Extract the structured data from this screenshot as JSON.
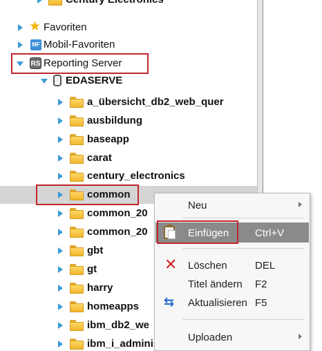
{
  "tree": {
    "items": [
      {
        "label": "Century Electronics",
        "bold": true
      },
      {
        "label": "Favoriten"
      },
      {
        "label": "Mobil-Favoriten",
        "icon_text": "MF"
      },
      {
        "label": "Reporting Server",
        "icon_text": "RS"
      },
      {
        "label": "EDASERVE",
        "bold": true
      },
      {
        "label": "a_übersicht_db2_web_quer",
        "bold": true
      },
      {
        "label": "ausbildung",
        "bold": true
      },
      {
        "label": "baseapp",
        "bold": true
      },
      {
        "label": "carat",
        "bold": true
      },
      {
        "label": "century_electronics",
        "bold": true
      },
      {
        "label": "common",
        "bold": true
      },
      {
        "label": "common_20",
        "bold": true
      },
      {
        "label": "common_20",
        "bold": true
      },
      {
        "label": "gbt",
        "bold": true
      },
      {
        "label": "gt",
        "bold": true
      },
      {
        "label": "harry",
        "bold": true
      },
      {
        "label": "homeapps",
        "bold": true
      },
      {
        "label": "ibm_db2_we",
        "bold": true
      },
      {
        "label": "ibm_i_administration_samp",
        "bold": true
      }
    ]
  },
  "context_menu": {
    "items": [
      {
        "label": "Neu",
        "shortcut": "",
        "has_submenu": true
      },
      {
        "label": "Einfügen",
        "shortcut": "Ctrl+V",
        "active": true
      },
      {
        "label": "Löschen",
        "shortcut": "DEL"
      },
      {
        "label": "Titel ändern",
        "shortcut": "F2"
      },
      {
        "label": "Aktualisieren",
        "shortcut": "F5"
      },
      {
        "label": "Uploaden",
        "shortcut": "",
        "has_submenu": true
      }
    ]
  },
  "colors": {
    "expander": "#3a9ad6",
    "highlight_box": "#c0262c",
    "selected_row": "#d5d5d5",
    "menu_active": "#8a8a8a",
    "folder": "#f1b62e",
    "star": "#f0b400",
    "delete_icon": "#d01f1f",
    "refresh_icon": "#1f66c8"
  },
  "icons": {
    "expander_collapsed": "triangle-right",
    "expander_expanded": "triangle-down",
    "folder": "folder-icon",
    "favorites": "star-icon",
    "mobile_favorites": "mf-icon",
    "reporting_server": "rs-icon",
    "edaserve": "database-icon",
    "paste": "clipboard-icon",
    "delete": "x-icon",
    "refresh": "refresh-icon"
  }
}
